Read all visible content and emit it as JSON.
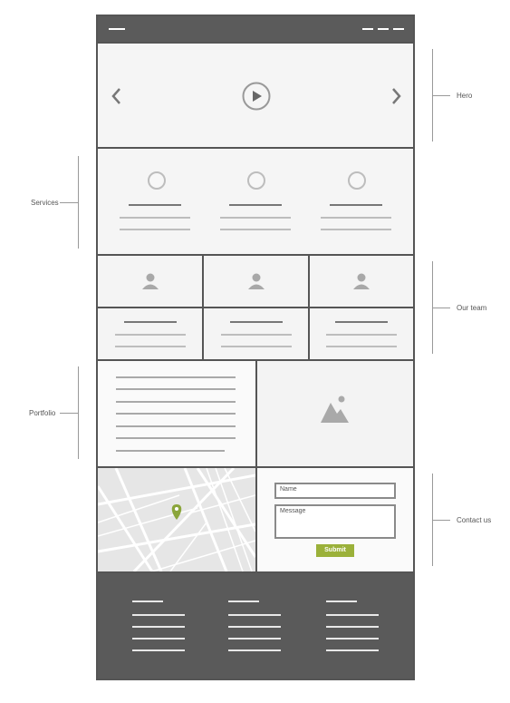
{
  "labels": {
    "hero": "Hero",
    "services": "Services",
    "our_team": "Our team",
    "portfolio": "Portfolio",
    "contact_us": "Contact us"
  },
  "contact": {
    "name_placeholder": "Name",
    "message_placeholder": "Message",
    "submit_label": "Submit"
  },
  "colors": {
    "frame": "#555555",
    "header": "#5b5b5b",
    "footer": "#5a5a5a",
    "accent": "#9bb13a",
    "map_pin": "#8aa53a"
  },
  "icons": {
    "menu": "hamburger-icon",
    "nav": "nav-links-icon",
    "prev": "chevron-left-icon",
    "next": "chevron-right-icon",
    "play": "play-icon",
    "service": "circle-icon",
    "member": "user-icon",
    "portfolio": "image-icon",
    "map": "map-pin-icon"
  }
}
